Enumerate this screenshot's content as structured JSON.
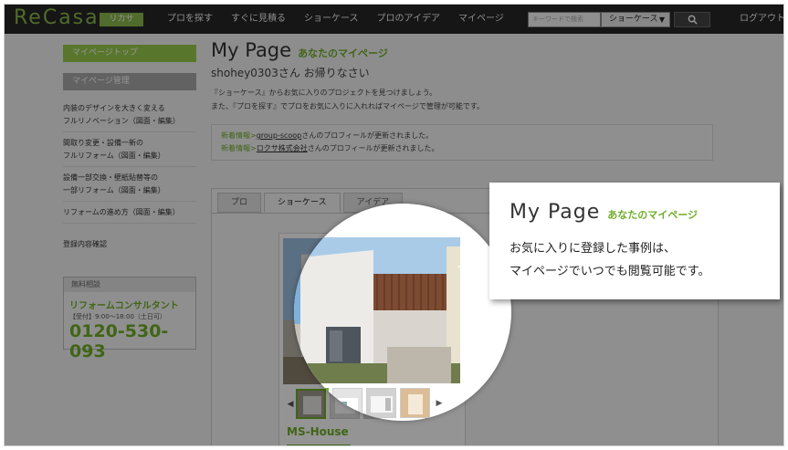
{
  "header": {
    "logo": "ReCasa",
    "logo_badge": "リカサ",
    "nav": [
      "プロを探す",
      "すぐに見積る",
      "ショーケース",
      "プロのアイデア",
      "マイページ"
    ],
    "search_placeholder": "キーワードで検索",
    "search_category": "ショーケース",
    "logout": "ログアウト"
  },
  "sidebar": {
    "mypage_top": "マイページトップ",
    "mypage_manage": "マイページ管理",
    "links": [
      {
        "line1": "内装のデザインを大きく変える",
        "line2": "フルリノベーション（図面・編集）"
      },
      {
        "line1": "間取り変更・設備一新の",
        "line2": "フルリフォーム（図面・編集）"
      },
      {
        "line1": "設備一部交換・壁紙貼替等の",
        "line2": "一部リフォーム（図面・編集）"
      },
      {
        "line1": "リフォームの進め方（図面・編集）",
        "line2": ""
      }
    ],
    "registration": "登録内容確認",
    "consult": {
      "heading": "無料相談",
      "title": "リフォームコンサルタント",
      "hours": "【受付】9:00〜18:00（土日可）",
      "phone": "0120-530-093"
    }
  },
  "main": {
    "title": "My Page",
    "subtitle": "あなたのマイページ",
    "welcome": "shohey0303さん お帰りなさい",
    "intro1": "『ショーケース』からお気に入りのプロジェクトを見つけましょう。",
    "intro2": "また、『プロを探す』でプロをお気に入りに入れればマイページで管理が可能です。",
    "notices": [
      {
        "label": "新着情報>",
        "link": "group-scoop",
        "text": "さんのプロフィールが更新されました。"
      },
      {
        "label": "新着情報>",
        "link": "ロクサ株式会社",
        "text": "さんのプロフィールが更新されました。"
      }
    ],
    "tabs": [
      "プロ",
      "ショーケース",
      "アイデア"
    ],
    "card": {
      "name": "MS-House"
    }
  },
  "callout": {
    "title": "My Page",
    "subtitle": "あなたのマイページ",
    "line1": "お気に入りに登録した事例は、",
    "line2": "マイページでいつでも閲覧可能です。"
  },
  "colors": {
    "accent": "#8ab84a",
    "accent_text": "#6fae27",
    "topbar": "#262626"
  }
}
